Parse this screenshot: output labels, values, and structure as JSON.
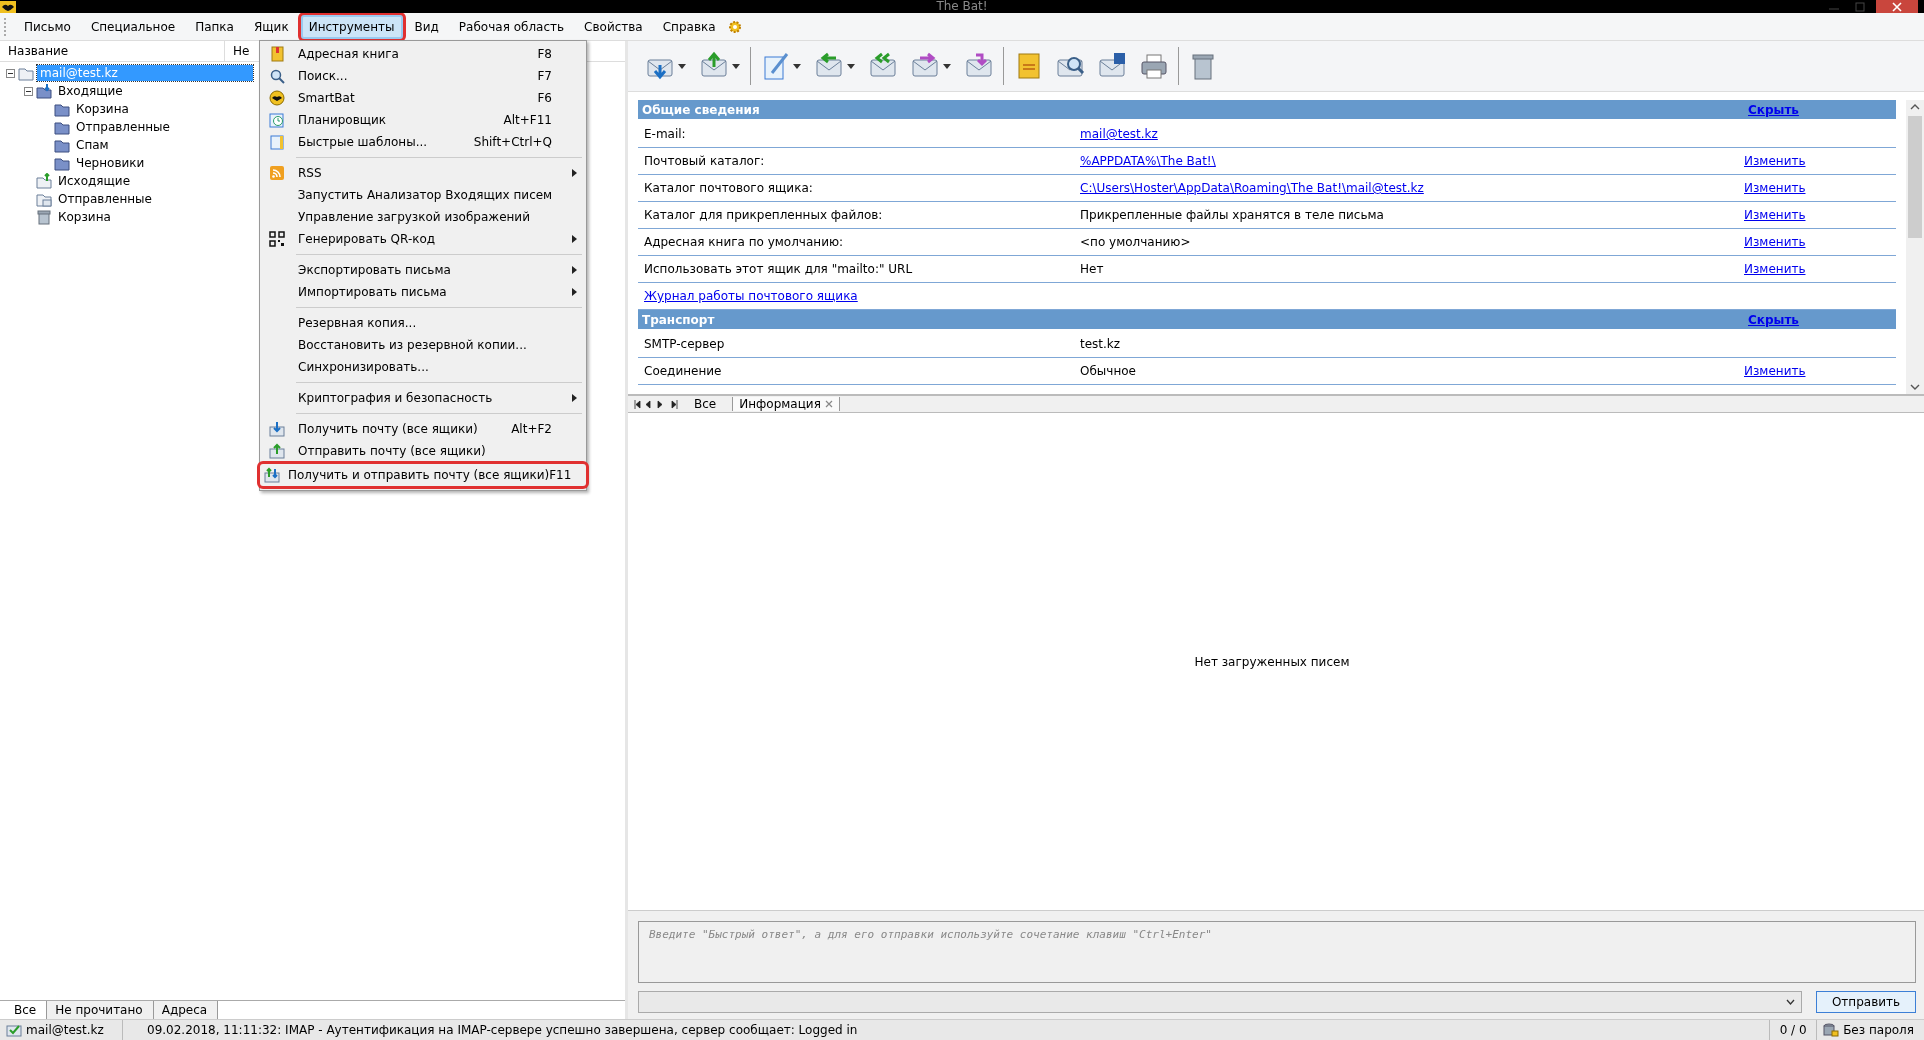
{
  "window": {
    "title": "The Bat!"
  },
  "menubar": [
    {
      "label": "Письмо",
      "selected": false,
      "outlined": false
    },
    {
      "label": "Специальное",
      "selected": false,
      "outlined": false
    },
    {
      "label": "Папка",
      "selected": false,
      "outlined": false
    },
    {
      "label": "Ящик",
      "selected": false,
      "outlined": false
    },
    {
      "label": "Инструменты",
      "selected": true,
      "outlined": true
    },
    {
      "label": "Вид",
      "selected": false,
      "outlined": false
    },
    {
      "label": "Рабочая область",
      "selected": false,
      "outlined": false
    },
    {
      "label": "Свойства",
      "selected": false,
      "outlined": false
    },
    {
      "label": "Справка",
      "selected": false,
      "outlined": false
    }
  ],
  "folder_tree": {
    "columns": [
      "Название",
      "Не"
    ],
    "items": [
      {
        "label": "mail@test.kz",
        "kind": "account",
        "selected": true,
        "expanded": true,
        "children": [
          {
            "label": "Входящие",
            "kind": "inbox",
            "selected": false,
            "expanded": true,
            "children": [
              {
                "label": "Корзина",
                "kind": "folder",
                "selected": false
              },
              {
                "label": "Отправленные",
                "kind": "folder",
                "selected": false
              },
              {
                "label": "Спам",
                "kind": "folder",
                "selected": false
              },
              {
                "label": "Черновики",
                "kind": "folder",
                "selected": false
              }
            ]
          },
          {
            "label": "Исходящие",
            "kind": "outbox",
            "selected": false
          },
          {
            "label": "Отправленные",
            "kind": "sent",
            "selected": false
          },
          {
            "label": "Корзина",
            "kind": "trash",
            "selected": false
          }
        ]
      }
    ],
    "tabs": [
      {
        "label": "Все",
        "selected": true
      },
      {
        "label": "Не прочитано",
        "selected": false
      },
      {
        "label": "Адреса",
        "selected": false
      }
    ]
  },
  "tools_menu": {
    "groups": [
      [
        {
          "label": "Адресная книга",
          "shortcut": "F8",
          "kind": "addressbook",
          "submenu": false,
          "outlined": false
        },
        {
          "label": "Поиск...",
          "shortcut": "F7",
          "kind": "search",
          "submenu": false,
          "outlined": false
        },
        {
          "label": "SmartBat",
          "shortcut": "F6",
          "kind": "bat",
          "submenu": false,
          "outlined": false
        },
        {
          "label": "Планировщик",
          "shortcut": "Alt+F11",
          "kind": "clock",
          "submenu": false,
          "outlined": false
        },
        {
          "label": "Быстрые шаблоны...",
          "shortcut": "Shift+Ctrl+Q",
          "kind": "template",
          "submenu": false,
          "outlined": false
        }
      ],
      [
        {
          "label": "RSS",
          "kind": "rss",
          "submenu": true,
          "outlined": false
        },
        {
          "label": "Запустить Анализатор Входящих писем",
          "kind": "none",
          "submenu": false,
          "outlined": false
        },
        {
          "label": "Управление загрузкой изображений",
          "kind": "none",
          "submenu": false,
          "outlined": false
        },
        {
          "label": "Генерировать QR-код",
          "kind": "qr",
          "submenu": true,
          "outlined": false
        }
      ],
      [
        {
          "label": "Экспортировать письма",
          "kind": "none",
          "submenu": true,
          "outlined": false
        },
        {
          "label": "Импортировать письма",
          "kind": "none",
          "submenu": true,
          "outlined": false
        }
      ],
      [
        {
          "label": "Резервная копия...",
          "kind": "none",
          "submenu": false,
          "outlined": false
        },
        {
          "label": "Восстановить из резервной копии...",
          "kind": "none",
          "submenu": false,
          "outlined": false
        },
        {
          "label": "Синхронизировать...",
          "kind": "none",
          "submenu": false,
          "outlined": false
        }
      ],
      [
        {
          "label": "Криптография и безопасность",
          "kind": "none",
          "submenu": true,
          "outlined": false
        }
      ],
      [
        {
          "label": "Получить почту (все ящики)",
          "shortcut": "Alt+F2",
          "kind": "receive",
          "submenu": false,
          "outlined": false
        },
        {
          "label": "Отправить почту (все ящики)",
          "kind": "send",
          "submenu": false,
          "outlined": false
        },
        {
          "label": "Получить и отправить почту (все ящики)",
          "shortcut": "F11",
          "kind": "sendreceive",
          "submenu": false,
          "outlined": true
        }
      ]
    ]
  },
  "toolbar": [
    {
      "kind": "receive",
      "dropdown": true
    },
    {
      "kind": "send",
      "dropdown": true
    },
    {
      "kind": "separator"
    },
    {
      "kind": "compose",
      "dropdown": true
    },
    {
      "kind": "reply",
      "dropdown": true
    },
    {
      "kind": "replyall",
      "dropdown": false
    },
    {
      "kind": "forward",
      "dropdown": true
    },
    {
      "kind": "redirect",
      "dropdown": false
    },
    {
      "kind": "separator"
    },
    {
      "kind": "spell",
      "dropdown": false
    },
    {
      "kind": "find",
      "dropdown": false
    },
    {
      "kind": "save",
      "dropdown": false
    },
    {
      "kind": "print",
      "dropdown": false
    },
    {
      "kind": "separator"
    },
    {
      "kind": "trash",
      "dropdown": false
    }
  ],
  "info": {
    "sections": [
      {
        "title": "Общие сведения",
        "hide": "Скрыть",
        "rows": [
          {
            "kind": "field",
            "label": "E-mail:",
            "value": "mail@test.kz",
            "value_link": true
          },
          {
            "kind": "field",
            "label": "Почтовый каталог:",
            "value": "%APPDATA%\\The Bat!\\",
            "value_link": true,
            "action": "Изменить"
          },
          {
            "kind": "field",
            "label": "Каталог почтового ящика:",
            "value": "C:\\Users\\Hoster\\AppData\\Roaming\\The Bat!\\mail@test.kz",
            "value_link": true,
            "action": "Изменить"
          },
          {
            "kind": "field",
            "label": "Каталог для прикрепленных файлов:",
            "value": "Прикрепленные файлы хранятся в теле письма",
            "value_link": false,
            "action": "Изменить"
          },
          {
            "kind": "field",
            "label": "Адресная книга по умолчанию:",
            "value": "<по умолчанию>",
            "value_link": false,
            "action": "Изменить"
          },
          {
            "kind": "field",
            "label": "Использовать этот ящик для \"mailto:\" URL",
            "value": "Нет",
            "value_link": false,
            "action": "Изменить"
          },
          {
            "kind": "link",
            "label": "Журнал работы почтового ящика"
          }
        ]
      },
      {
        "title": "Транспорт",
        "hide": "Скрыть",
        "rows": [
          {
            "kind": "field",
            "label": "SMTP-сервер",
            "value": "test.kz",
            "value_link": false
          },
          {
            "kind": "field",
            "label": "Соединение",
            "value": "Обычное",
            "value_link": false,
            "action": "Изменить"
          }
        ]
      }
    ]
  },
  "viewer_tabs": [
    {
      "label": "Все",
      "selected": false,
      "closable": false
    },
    {
      "label": "Информация",
      "selected": true,
      "closable": true
    }
  ],
  "message_list": {
    "empty_text": "Нет загруженных писем"
  },
  "quick_reply": {
    "placeholder": "Введите \"Быстрый ответ\", а для его отправки используйте сочетание клавиш \"Ctrl+Enter\"",
    "send_button": "Отправить"
  },
  "status_bar": {
    "account": "mail@test.kz",
    "message": "09.02.2018, 11:11:32: IMAP  - Аутентификация на IMAP-сервере успешно завершена, сервер сообщает: Logged in",
    "counter": "0 / 0",
    "password": "Без пароля"
  }
}
